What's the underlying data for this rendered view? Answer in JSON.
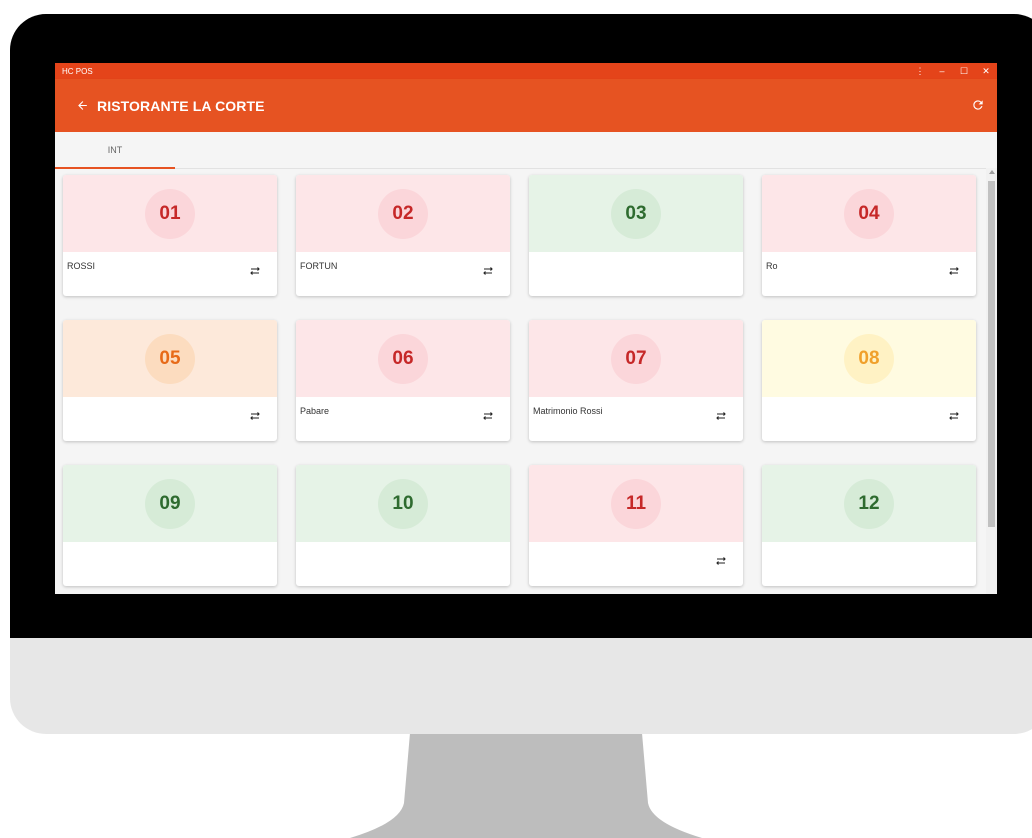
{
  "window": {
    "title": "HC POS"
  },
  "appbar": {
    "title": "RISTORANTE LA CORTE"
  },
  "tabs": [
    {
      "label": "INT"
    }
  ],
  "tables": [
    {
      "number": "01",
      "name": "ROSSI",
      "status": "red",
      "transfer": true
    },
    {
      "number": "02",
      "name": "FORTUN",
      "status": "red",
      "transfer": true
    },
    {
      "number": "03",
      "name": "",
      "status": "green",
      "transfer": false
    },
    {
      "number": "04",
      "name": "Ro",
      "status": "red",
      "transfer": true
    },
    {
      "number": "05",
      "name": "",
      "status": "orange",
      "transfer": true
    },
    {
      "number": "06",
      "name": "Pabare",
      "status": "red",
      "transfer": true
    },
    {
      "number": "07",
      "name": "Matrimonio Rossi",
      "status": "red",
      "transfer": true
    },
    {
      "number": "08",
      "name": "",
      "status": "yellow",
      "transfer": true
    },
    {
      "number": "09",
      "name": "",
      "status": "green",
      "transfer": false
    },
    {
      "number": "10",
      "name": "",
      "status": "green",
      "transfer": false
    },
    {
      "number": "11",
      "name": "",
      "status": "red",
      "transfer": true
    },
    {
      "number": "12",
      "name": "",
      "status": "green",
      "transfer": false
    }
  ],
  "colors": {
    "accent": "#e65322",
    "titlebar": "#e4441a",
    "red_text": "#c62828",
    "green_text": "#2e6b2f",
    "orange_text": "#e76a18",
    "yellow_text": "#f0a02b"
  },
  "icons": {
    "back": "arrow-left-icon",
    "refresh": "refresh-icon",
    "transfer": "swap-arrows-icon"
  }
}
